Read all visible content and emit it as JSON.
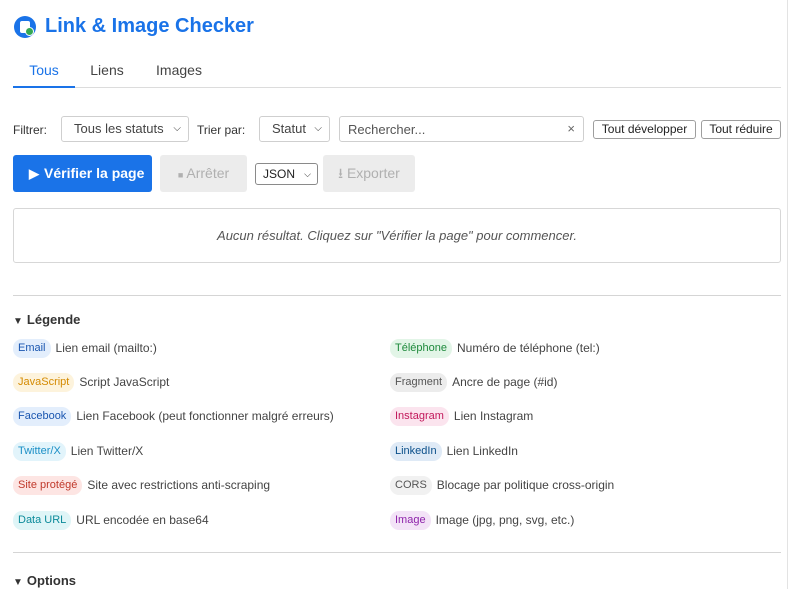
{
  "app": {
    "title": "Link & Image Checker"
  },
  "tabs": [
    {
      "label": "Tous",
      "active": true
    },
    {
      "label": "Liens",
      "active": false
    },
    {
      "label": "Images",
      "active": false
    }
  ],
  "filters": {
    "filter_label": "Filtrer:",
    "status_select": "Tous les statuts",
    "sort_label": "Trier par:",
    "sort_select": "Statut",
    "search_placeholder": "Rechercher...",
    "clear_symbol": "×",
    "expand_all": "Tout développer",
    "collapse_all": "Tout réduire"
  },
  "actions": {
    "verify_icon": "▶",
    "verify_label": "Vérifier la page",
    "stop_icon": "■",
    "stop_label": "Arrêter",
    "format_select": "JSON",
    "export_icon": "⭳",
    "export_label": "Exporter"
  },
  "results": {
    "empty_message": "Aucun résultat. Cliquez sur \"Vérifier la page\" pour commencer."
  },
  "legend": {
    "title": "Légende",
    "left": [
      {
        "badge": "Email",
        "desc": "Lien email (mailto:)",
        "color": "#1a56b0",
        "bg": "#e3eefc"
      },
      {
        "badge": "JavaScript",
        "desc": "Script JavaScript",
        "color": "#d48a00",
        "bg": "#fdf3dc"
      },
      {
        "badge": "Facebook",
        "desc": "Lien Facebook (peut fonctionner malgré erreurs)",
        "color": "#1a56b0",
        "bg": "#e3eefc"
      },
      {
        "badge": "Twitter/X",
        "desc": "Lien Twitter/X",
        "color": "#1b8fc6",
        "bg": "#e2f4fb"
      },
      {
        "badge": "Site protégé",
        "desc": "Site avec restrictions anti-scraping",
        "color": "#c0392b",
        "bg": "#fde5e3"
      },
      {
        "badge": "Data URL",
        "desc": "URL encodée en base64",
        "color": "#0b8a9a",
        "bg": "#dff5f7"
      }
    ],
    "right": [
      {
        "badge": "Téléphone",
        "desc": "Numéro de téléphone (tel:)",
        "color": "#1e8a3c",
        "bg": "#e2f5e7"
      },
      {
        "badge": "Fragment",
        "desc": "Ancre de page (#id)",
        "color": "#555555",
        "bg": "#ececec"
      },
      {
        "badge": "Instagram",
        "desc": "Lien Instagram",
        "color": "#c2185b",
        "bg": "#fbe4ee"
      },
      {
        "badge": "LinkedIn",
        "desc": "Lien LinkedIn",
        "color": "#0a4f8a",
        "bg": "#dfeaf6"
      },
      {
        "badge": "CORS",
        "desc": "Blocage par politique cross-origin",
        "color": "#555555",
        "bg": "#f1f1f1"
      },
      {
        "badge": "Image",
        "desc": "Image (jpg, png, svg, etc.)",
        "color": "#8e24aa",
        "bg": "#f3e3f7"
      }
    ]
  },
  "options": {
    "title": "Options"
  }
}
